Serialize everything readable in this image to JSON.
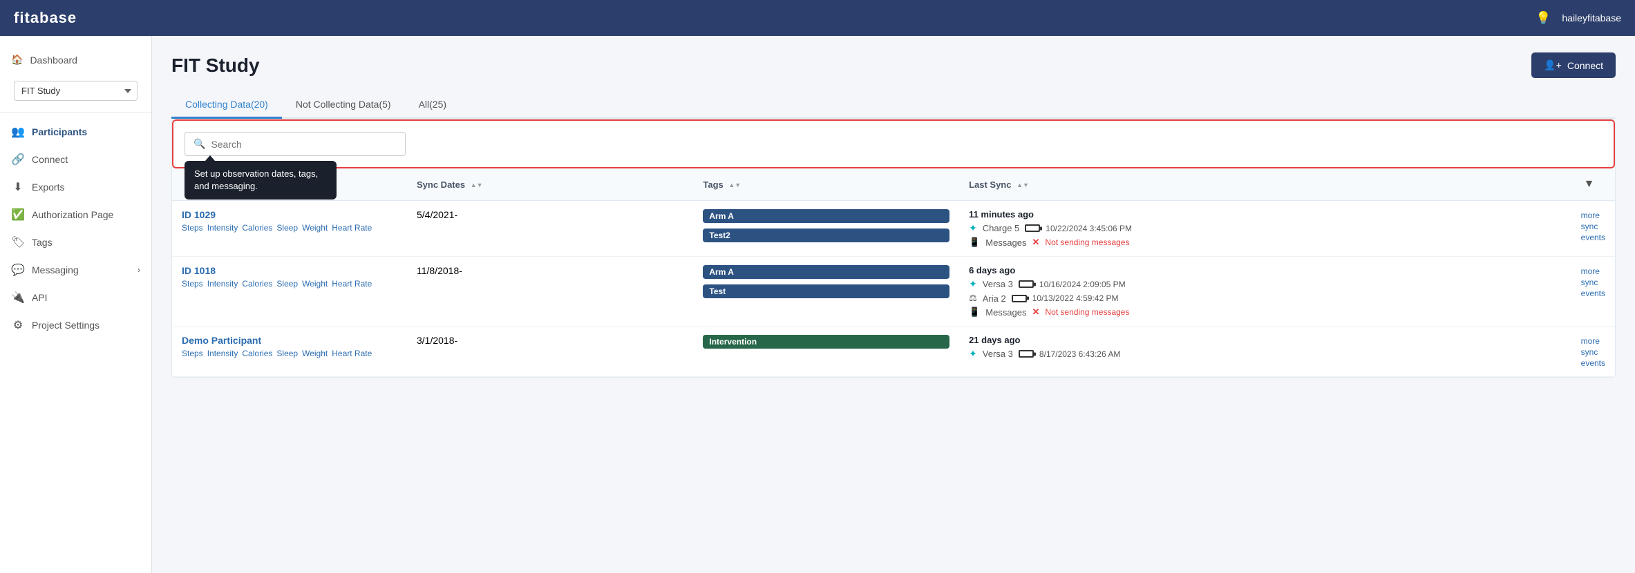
{
  "app": {
    "name": "fitabase",
    "user": "haileyfitabase"
  },
  "sidebar": {
    "dashboard_label": "Dashboard",
    "study_selector": "FIT Study",
    "nav_items": [
      {
        "id": "participants",
        "label": "Participants",
        "icon": "👥",
        "active": true
      },
      {
        "id": "connect",
        "label": "Connect",
        "icon": "🔗"
      },
      {
        "id": "exports",
        "label": "Exports",
        "icon": "⬇"
      },
      {
        "id": "authorization",
        "label": "Authorization Page",
        "icon": "✅"
      },
      {
        "id": "tags",
        "label": "Tags",
        "icon": "🏷"
      },
      {
        "id": "messaging",
        "label": "Messaging",
        "icon": "💬",
        "has_chevron": true
      },
      {
        "id": "api",
        "label": "API",
        "icon": "🔌"
      },
      {
        "id": "settings",
        "label": "Project Settings",
        "icon": "⚙"
      }
    ]
  },
  "page": {
    "title": "FIT Study",
    "connect_button": "Connect"
  },
  "tabs": [
    {
      "label": "Collecting Data(20)",
      "active": true
    },
    {
      "label": "Not Collecting Data(5)",
      "active": false
    },
    {
      "label": "All(25)",
      "active": false
    }
  ],
  "search": {
    "placeholder": "Search"
  },
  "tooltip": {
    "text": "Set up observation dates, tags, and messaging."
  },
  "table": {
    "columns": [
      {
        "label": "Sync Dates",
        "sortable": true
      },
      {
        "label": "Tags",
        "sortable": true
      },
      {
        "label": "Last Sync",
        "sortable": true
      }
    ],
    "participants": [
      {
        "id": "ID 1029",
        "data_types": [
          "Steps",
          "Intensity",
          "Calories",
          "Sleep",
          "Weight",
          "Heart Rate"
        ],
        "sync_dates": "5/4/2021-",
        "tags": [
          "Arm A",
          "Test2"
        ],
        "last_sync_label": "11 minutes ago",
        "devices": [
          {
            "icon": "fitbit",
            "name": "Charge 5",
            "battery": "green",
            "last_sync": "10/22/2024 3:45:06 PM"
          },
          {
            "icon": "phone",
            "name": "Messages",
            "status": "Not sending messages",
            "status_ok": false
          }
        ],
        "more_sync_link": "more sync events"
      },
      {
        "id": "ID 1018",
        "data_types": [
          "Steps",
          "Intensity",
          "Calories",
          "Sleep",
          "Weight",
          "Heart Rate"
        ],
        "sync_dates": "11/8/2018-",
        "tags": [
          "Arm A",
          "Test"
        ],
        "last_sync_label": "6 days ago",
        "devices": [
          {
            "icon": "fitbit",
            "name": "Versa 3",
            "battery": "green",
            "last_sync": "10/16/2024 2:09:05 PM"
          },
          {
            "icon": "scale",
            "name": "Aria 2",
            "battery": "orange",
            "last_sync": "10/13/2022 4:59:42 PM"
          },
          {
            "icon": "phone",
            "name": "Messages",
            "status": "Not sending messages",
            "status_ok": false
          }
        ],
        "more_sync_link": "more sync events"
      },
      {
        "id": "Demo Participant",
        "data_types": [
          "Steps",
          "Intensity",
          "Calories",
          "Sleep",
          "Weight",
          "Heart Rate"
        ],
        "sync_dates": "3/1/2018-",
        "tags": [
          "Intervention"
        ],
        "last_sync_label": "21 days ago",
        "devices": [
          {
            "icon": "fitbit",
            "name": "Versa 3",
            "battery": "yellow",
            "last_sync": "8/17/2023 6:43:26 AM"
          }
        ],
        "more_sync_link": "more sync events"
      }
    ]
  }
}
